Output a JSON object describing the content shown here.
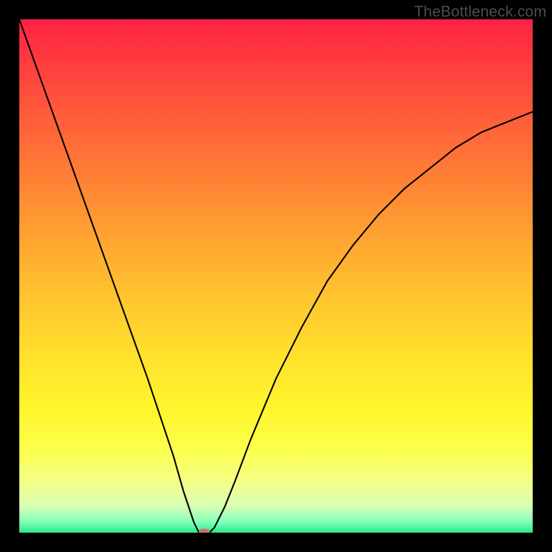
{
  "watermark": "TheBottleneck.com",
  "chart_data": {
    "type": "line",
    "title": "",
    "xlabel": "",
    "ylabel": "",
    "xlim": [
      0,
      100
    ],
    "ylim": [
      0,
      100
    ],
    "x": [
      0,
      5,
      10,
      15,
      20,
      25,
      30,
      32,
      34,
      35,
      36,
      37,
      38,
      40,
      42,
      45,
      50,
      55,
      60,
      65,
      70,
      75,
      80,
      85,
      90,
      95,
      100
    ],
    "values": [
      100,
      86,
      72,
      58,
      44,
      30,
      15,
      8,
      2,
      0,
      0,
      0,
      1,
      5,
      10,
      18,
      30,
      40,
      49,
      56,
      62,
      67,
      71,
      75,
      78,
      80,
      82
    ],
    "minimum_marker": {
      "x": 36,
      "y": 0
    },
    "gradient_colors_top_to_bottom": [
      "#ff2244",
      "#ffa231",
      "#fff62d",
      "#27e88c"
    ]
  }
}
